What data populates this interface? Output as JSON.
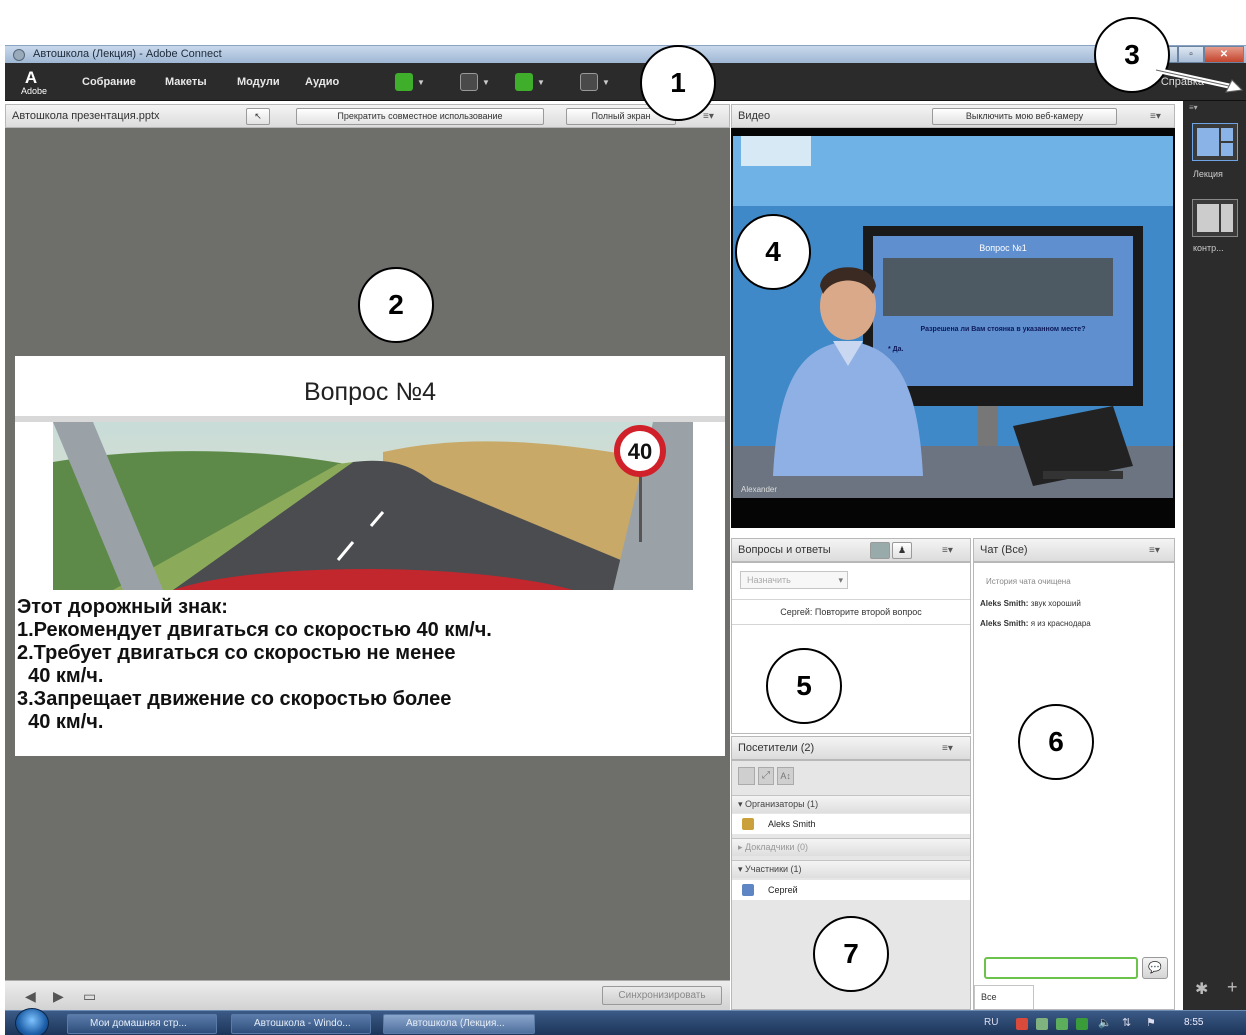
{
  "window": {
    "title": "Автошкола (Лекция) - Adobe Connect"
  },
  "menubar": {
    "adobe_label": "Adobe",
    "items": [
      "Собрание",
      "Макеты",
      "Модули",
      "Аудио"
    ],
    "help_label": "Справка"
  },
  "share_pod": {
    "title": "Автошкола презентация.pptx",
    "stop_sharing_button": "Прекратить совместное использование",
    "fullscreen_button": "Полный экран",
    "sync_button": "Синхронизировать",
    "slide": {
      "title": "Вопрос №4",
      "speed_sign": "40",
      "lines": [
        "Этот дорожный знак:",
        "1.Рекомендует двигаться со скоростью 40 км/ч.",
        "2.Требует двигаться со скоростью не менее",
        "  40 км/ч.",
        "3.Запрещает движение со скоростью более",
        "  40 км/ч."
      ]
    }
  },
  "video_pod": {
    "title": "Видео",
    "webcam_button": "Выключить мою веб-камеру",
    "screen_title": "Вопрос №1",
    "screen_question": "Разрешена ли Вам стоянка в указанном месте?",
    "screen_answer": "* Да.",
    "caption": "Alexander"
  },
  "qna_pod": {
    "title": "Вопросы и ответы",
    "filter_placeholder": "Назначить",
    "question": "Сергей: Повторите второй вопрос"
  },
  "attendees_pod": {
    "title": "Посетители",
    "count": "(2)",
    "sections": [
      {
        "label": "Организаторы (1)",
        "members": [
          "Aleks Smith"
        ]
      },
      {
        "label": "Докладчики (0)",
        "members": []
      },
      {
        "label": "Участники (1)",
        "members": [
          "Сергей"
        ]
      }
    ]
  },
  "chat_pod": {
    "title": "Чат",
    "scope": "(Все)",
    "history_cleared": "История чата очищена",
    "messages": [
      {
        "author": "Aleks Smith:",
        "text": "звук хороший"
      },
      {
        "author": "Aleks Smith:",
        "text": "я из краснодара"
      }
    ],
    "tab_label": "Все"
  },
  "layouts_bar": {
    "layouts": [
      {
        "label": "Лекция"
      },
      {
        "label": "контр..."
      }
    ]
  },
  "taskbar": {
    "buttons": [
      "Мои домашняя стр...",
      "Автошкола - Windo...",
      "Автошкола (Лекция..."
    ],
    "language": "RU",
    "time": "8:55"
  },
  "callouts": [
    "1",
    "2",
    "3",
    "4",
    "5",
    "6",
    "7"
  ],
  "colors": {
    "menubar_bg": "#2b2b2b",
    "share_bg": "#6e6f6b",
    "sign_red": "#d0212a",
    "chat_input_border": "#6cc24a"
  }
}
